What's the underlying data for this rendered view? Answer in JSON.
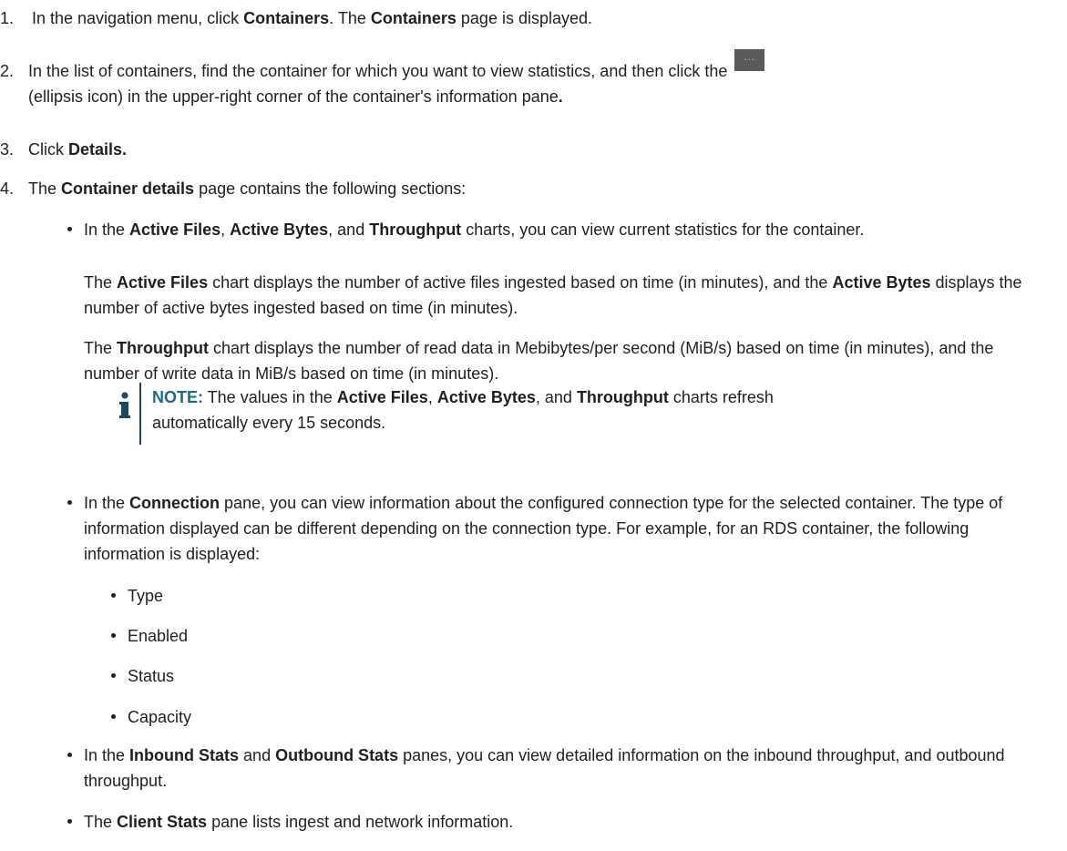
{
  "steps": [
    {
      "num": "1.",
      "t1": "In the navigation menu, click ",
      "b1": "Containers",
      "t2": ". The ",
      "b2": "Containers",
      "t3": " page is displayed."
    },
    {
      "num": "2.",
      "t1": "In the list of containers, find the container for which you want to view statistics, and then click the",
      "icon_label": "...",
      "t2": "(ellipsis icon) in the upper-right corner of the container's information pane",
      "b_end": "."
    },
    {
      "num": "3.",
      "t1": "Click ",
      "b1": "Details."
    },
    {
      "num": "4.",
      "t1": "The ",
      "b1": "Container details",
      "t2": " page contains the following sections:"
    }
  ],
  "b1": {
    "t1": "In the ",
    "b1": "Active Files",
    "t2": ", ",
    "b2": "Active Bytes",
    "t3": ", and ",
    "b3": "Throughput",
    "t4": " charts, you can view current statistics for the container."
  },
  "p1": {
    "t1": "The ",
    "b1": "Active Files",
    "t2": " chart displays the number of active files ingested based on time (in minutes), and the ",
    "b2": "Active Bytes",
    "t3": " displays the number of active bytes ingested based on time (in minutes)."
  },
  "p2": {
    "t1": "The ",
    "b1": "Throughput",
    "t2": " chart displays the number of read data in Mebibytes/per second (MiB/s) based on time (in minutes), and the number of write data in MiB/s based on time (in minutes)."
  },
  "note": {
    "label": "NOTE:",
    "t1": " The values in the ",
    "b1": "Active Files",
    "t2": ", ",
    "b2": "Active Bytes",
    "t3": ", and ",
    "b3": "Throughput",
    "t4": " charts refresh automatically every 15 seconds."
  },
  "b2": {
    "t1": "In the ",
    "b1": "Connection",
    "t2": " pane, you can view information about the configured connection type for the selected container. The type of information displayed can be different depending on the connection type. For example, for an RDS container, the following information is displayed:"
  },
  "sub": [
    "Type",
    "Enabled",
    "Status",
    "Capacity"
  ],
  "b3": {
    "t1": "In the ",
    "b1": "Inbound Stats",
    "t2": " and ",
    "b2": "Outbound Stats",
    "t3": " panes, you can view detailed information on the inbound throughput, and outbound throughput."
  },
  "b4": {
    "t1": "The ",
    "b1": "Client Stats",
    "t2": " pane lists ingest and network information."
  }
}
